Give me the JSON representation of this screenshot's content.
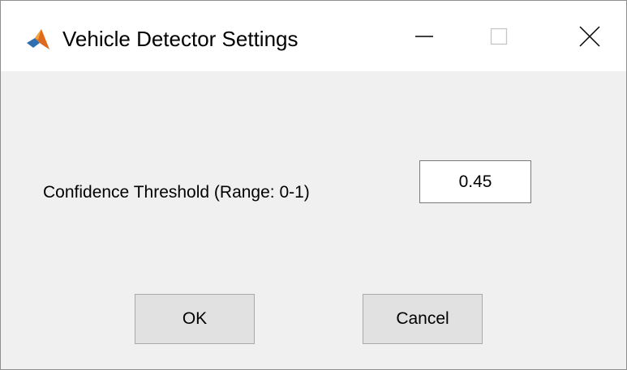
{
  "window": {
    "title": "Vehicle Detector Settings",
    "app_icon": "matlab-icon",
    "controls": {
      "minimize_icon": "minimize-icon",
      "maximize_icon": "maximize-icon",
      "close_icon": "close-icon"
    }
  },
  "form": {
    "threshold_label": "Confidence Threshold (Range: 0-1)",
    "threshold_value": "0.45"
  },
  "buttons": {
    "ok_label": "OK",
    "cancel_label": "Cancel"
  },
  "colors": {
    "titlebar_bg": "#ffffff",
    "content_bg": "#f0f0f0",
    "button_bg": "#e1e1e1"
  }
}
